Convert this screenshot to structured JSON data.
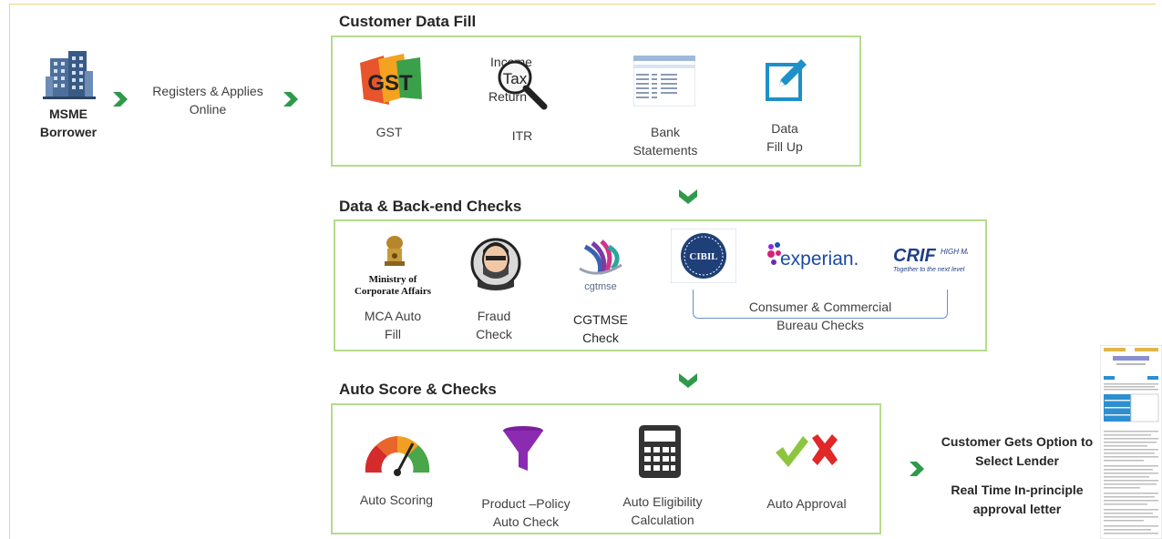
{
  "borrower": {
    "line1": "MSME",
    "line2": "Borrower"
  },
  "register": {
    "line1": "Registers & Applies",
    "line2": "Online"
  },
  "sections": {
    "customer_fill": {
      "title": "Customer Data Fill",
      "items": [
        {
          "label1": "GST",
          "label2": ""
        },
        {
          "label1": "ITR",
          "label2": ""
        },
        {
          "label1": "Bank",
          "label2": "Statements"
        },
        {
          "label1": "Data",
          "label2": "Fill Up"
        }
      ],
      "gst_logo_text": "GST",
      "itr_logo_text": {
        "l1": "Income",
        "l2": "Tax",
        "l3": "Return"
      }
    },
    "checks": {
      "title": "Data & Back-end Checks",
      "items": [
        {
          "label1": "MCA Auto",
          "label2": "Fill"
        },
        {
          "label1": "Fraud",
          "label2": "Check"
        },
        {
          "label1": "CGTMSE",
          "label2": "Check"
        }
      ],
      "mca_logo": {
        "l1": "Ministry of",
        "l2": "Corporate Affairs"
      },
      "cgtmse_logo": "cgtmse",
      "bureau_logos": {
        "cibil": "CIBIL",
        "experian": "experian.",
        "crif": "CRIF",
        "crif_sub": "HIGH MARK",
        "crif_tag": "Together to the next level"
      },
      "bureau_label1": "Consumer & Commercial",
      "bureau_label2": "Bureau Checks"
    },
    "auto_score": {
      "title": "Auto Score & Checks",
      "items": [
        {
          "label1": "Auto Scoring",
          "label2": ""
        },
        {
          "label1": "Product –Policy",
          "label2": "Auto Check"
        },
        {
          "label1": "Auto Eligibility",
          "label2": "Calculation"
        },
        {
          "label1": "Auto Approval",
          "label2": ""
        }
      ]
    }
  },
  "outcome": {
    "line1": "Customer Gets Option to",
    "line2": "Select Lender",
    "line3": "Real Time In-principle",
    "line4": "approval letter"
  },
  "colors": {
    "chevron": "#2e9a4a",
    "box_border": "#b4dc8c",
    "frame": "#f2d27a"
  }
}
